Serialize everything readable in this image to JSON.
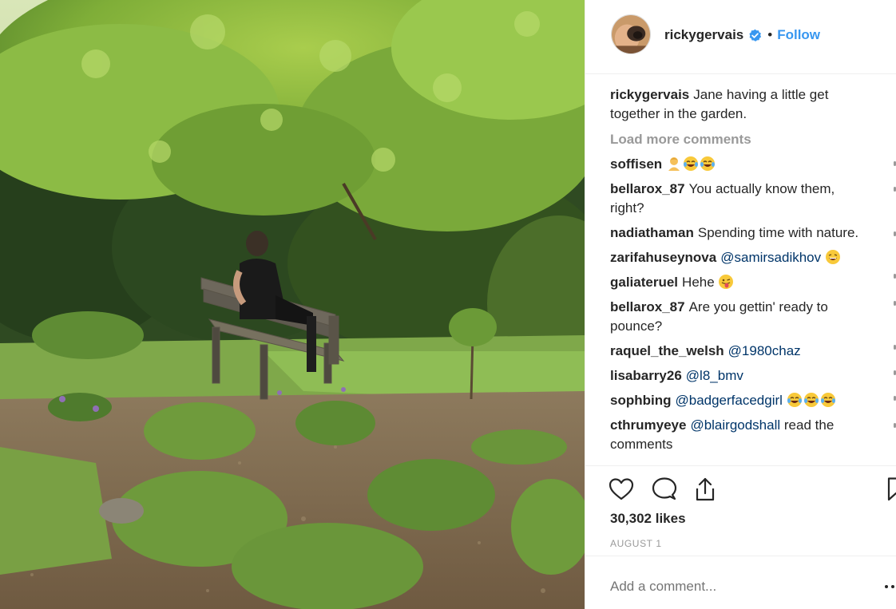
{
  "post": {
    "username": "rickygervais",
    "verified_icon": "verified-badge-icon",
    "separator": "•",
    "follow_label": "Follow",
    "accent_color": "#3897f0"
  },
  "caption": {
    "username": "rickygervais",
    "text": "Jane having a little get together in the garden."
  },
  "load_more_label": "Load more comments",
  "comments": [
    {
      "username": "soffisen",
      "text": "",
      "emojis": [
        "person-emoji",
        "laughing-tears-emoji",
        "laughing-tears-emoji"
      ]
    },
    {
      "username": "bellarox_87",
      "text": "You actually know them, right?"
    },
    {
      "username": "nadiathaman",
      "text": "Spending time with nature."
    },
    {
      "username": "zarifahuseynova",
      "mention": "@samirsadikhov",
      "emojis": [
        "grinning-emoji"
      ]
    },
    {
      "username": "galiateruel",
      "text": "Hehe",
      "emojis": [
        "winking-tongue-emoji"
      ]
    },
    {
      "username": "bellarox_87",
      "text": "Are you gettin' ready to pounce?"
    },
    {
      "username": "raquel_the_welsh",
      "mention": "@1980chaz"
    },
    {
      "username": "lisabarry26",
      "mention": "@l8_bmv"
    },
    {
      "username": "sophbing",
      "mention": "@badgerfacedgirl",
      "emojis": [
        "laughing-tears-emoji",
        "laughing-tears-emoji",
        "laughing-tears-emoji"
      ]
    },
    {
      "username": "cthrumyeye",
      "mention": "@blairgodshall",
      "text": "read the comments"
    }
  ],
  "actions": {
    "like_icon": "heart-icon",
    "comment_icon": "comment-bubble-icon",
    "share_icon": "share-upload-icon",
    "save_icon": "bookmark-icon"
  },
  "likes_label": "30,302 likes",
  "date_label": "AUGUST 1",
  "add_comment_placeholder": "Add a comment...",
  "more_icon": "more-options-icon"
}
